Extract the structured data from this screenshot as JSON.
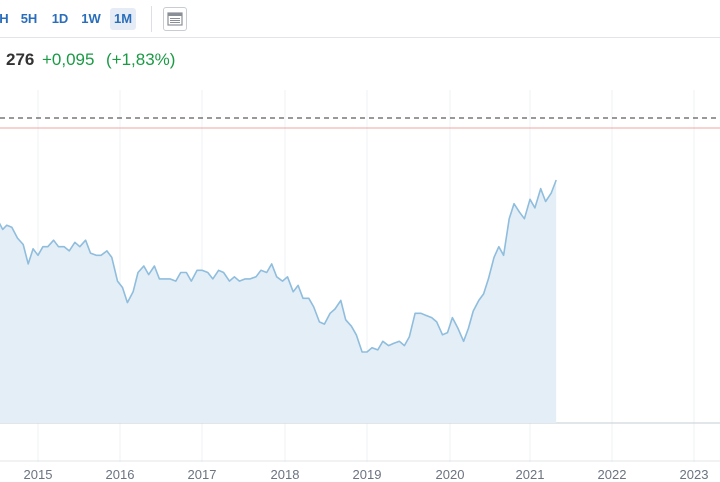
{
  "toolbar": {
    "timeframes": [
      {
        "label": "H",
        "active": false
      },
      {
        "label": "5H",
        "active": false
      },
      {
        "label": "1D",
        "active": false
      },
      {
        "label": "1W",
        "active": false
      },
      {
        "label": "1M",
        "active": true
      }
    ]
  },
  "quote": {
    "price": "276",
    "change": "+0,095",
    "change_pct": "(+1,83%)"
  },
  "colors": {
    "accent": "#2a6ebb",
    "positive": "#1b9a45",
    "line": "#8fbddd",
    "fill": "#e4eef6",
    "reference_red": "#f2a3a3",
    "reference_dashed": "#333333"
  },
  "chart_data": {
    "type": "area",
    "grid": "vertical",
    "x_ticks": [
      "2015",
      "2016",
      "2017",
      "2018",
      "2019",
      "2020",
      "2021",
      "2022",
      "2023"
    ],
    "xlim": [
      2014.5,
      2023.3
    ],
    "ylim": [
      0,
      100
    ],
    "values": [
      [
        2014.5,
        82
      ],
      [
        2014.57,
        77
      ],
      [
        2014.62,
        79
      ],
      [
        2014.68,
        78
      ],
      [
        2014.75,
        73
      ],
      [
        2014.82,
        70
      ],
      [
        2014.88,
        61
      ],
      [
        2014.94,
        68
      ],
      [
        2015.0,
        65
      ],
      [
        2015.06,
        69
      ],
      [
        2015.12,
        69
      ],
      [
        2015.19,
        72
      ],
      [
        2015.25,
        69
      ],
      [
        2015.32,
        69
      ],
      [
        2015.38,
        67
      ],
      [
        2015.45,
        71
      ],
      [
        2015.51,
        69
      ],
      [
        2015.58,
        72
      ],
      [
        2015.64,
        66
      ],
      [
        2015.71,
        65
      ],
      [
        2015.77,
        65
      ],
      [
        2015.84,
        67
      ],
      [
        2015.9,
        64
      ],
      [
        2015.97,
        53
      ],
      [
        2016.03,
        50
      ],
      [
        2016.09,
        43
      ],
      [
        2016.16,
        48
      ],
      [
        2016.22,
        57
      ],
      [
        2016.29,
        60
      ],
      [
        2016.35,
        56
      ],
      [
        2016.42,
        60
      ],
      [
        2016.48,
        54
      ],
      [
        2016.55,
        54
      ],
      [
        2016.61,
        54
      ],
      [
        2016.68,
        53
      ],
      [
        2016.74,
        57
      ],
      [
        2016.81,
        57
      ],
      [
        2016.87,
        53
      ],
      [
        2016.94,
        58
      ],
      [
        2017.0,
        58
      ],
      [
        2017.07,
        57
      ],
      [
        2017.13,
        54
      ],
      [
        2017.2,
        58
      ],
      [
        2017.26,
        57
      ],
      [
        2017.33,
        53
      ],
      [
        2017.39,
        55
      ],
      [
        2017.45,
        53
      ],
      [
        2017.52,
        54
      ],
      [
        2017.58,
        54
      ],
      [
        2017.65,
        55
      ],
      [
        2017.71,
        58
      ],
      [
        2017.78,
        57
      ],
      [
        2017.84,
        61
      ],
      [
        2017.9,
        55
      ],
      [
        2017.97,
        53
      ],
      [
        2018.03,
        55
      ],
      [
        2018.1,
        48
      ],
      [
        2018.16,
        51
      ],
      [
        2018.22,
        45
      ],
      [
        2018.29,
        45
      ],
      [
        2018.35,
        41
      ],
      [
        2018.42,
        34
      ],
      [
        2018.48,
        33
      ],
      [
        2018.55,
        38
      ],
      [
        2018.61,
        40
      ],
      [
        2018.68,
        44
      ],
      [
        2018.74,
        35
      ],
      [
        2018.81,
        32
      ],
      [
        2018.87,
        28
      ],
      [
        2018.94,
        20
      ],
      [
        2019.0,
        20
      ],
      [
        2019.06,
        22
      ],
      [
        2019.13,
        21
      ],
      [
        2019.19,
        25
      ],
      [
        2019.26,
        23
      ],
      [
        2019.32,
        24
      ],
      [
        2019.39,
        25
      ],
      [
        2019.45,
        23
      ],
      [
        2019.51,
        27
      ],
      [
        2019.58,
        38
      ],
      [
        2019.65,
        38
      ],
      [
        2019.71,
        37
      ],
      [
        2019.78,
        36
      ],
      [
        2019.84,
        34
      ],
      [
        2019.91,
        28
      ],
      [
        2019.97,
        29
      ],
      [
        2020.03,
        36
      ],
      [
        2020.1,
        31
      ],
      [
        2020.17,
        25
      ],
      [
        2020.23,
        31
      ],
      [
        2020.29,
        39
      ],
      [
        2020.36,
        44
      ],
      [
        2020.42,
        47
      ],
      [
        2020.48,
        54
      ],
      [
        2020.55,
        64
      ],
      [
        2020.61,
        69
      ],
      [
        2020.67,
        65
      ],
      [
        2020.74,
        82
      ],
      [
        2020.8,
        89
      ],
      [
        2020.87,
        85
      ],
      [
        2020.93,
        82
      ],
      [
        2021.0,
        91
      ],
      [
        2021.06,
        87
      ],
      [
        2021.13,
        96
      ],
      [
        2021.19,
        90
      ],
      [
        2021.26,
        94
      ],
      [
        2021.32,
        100
      ]
    ]
  }
}
